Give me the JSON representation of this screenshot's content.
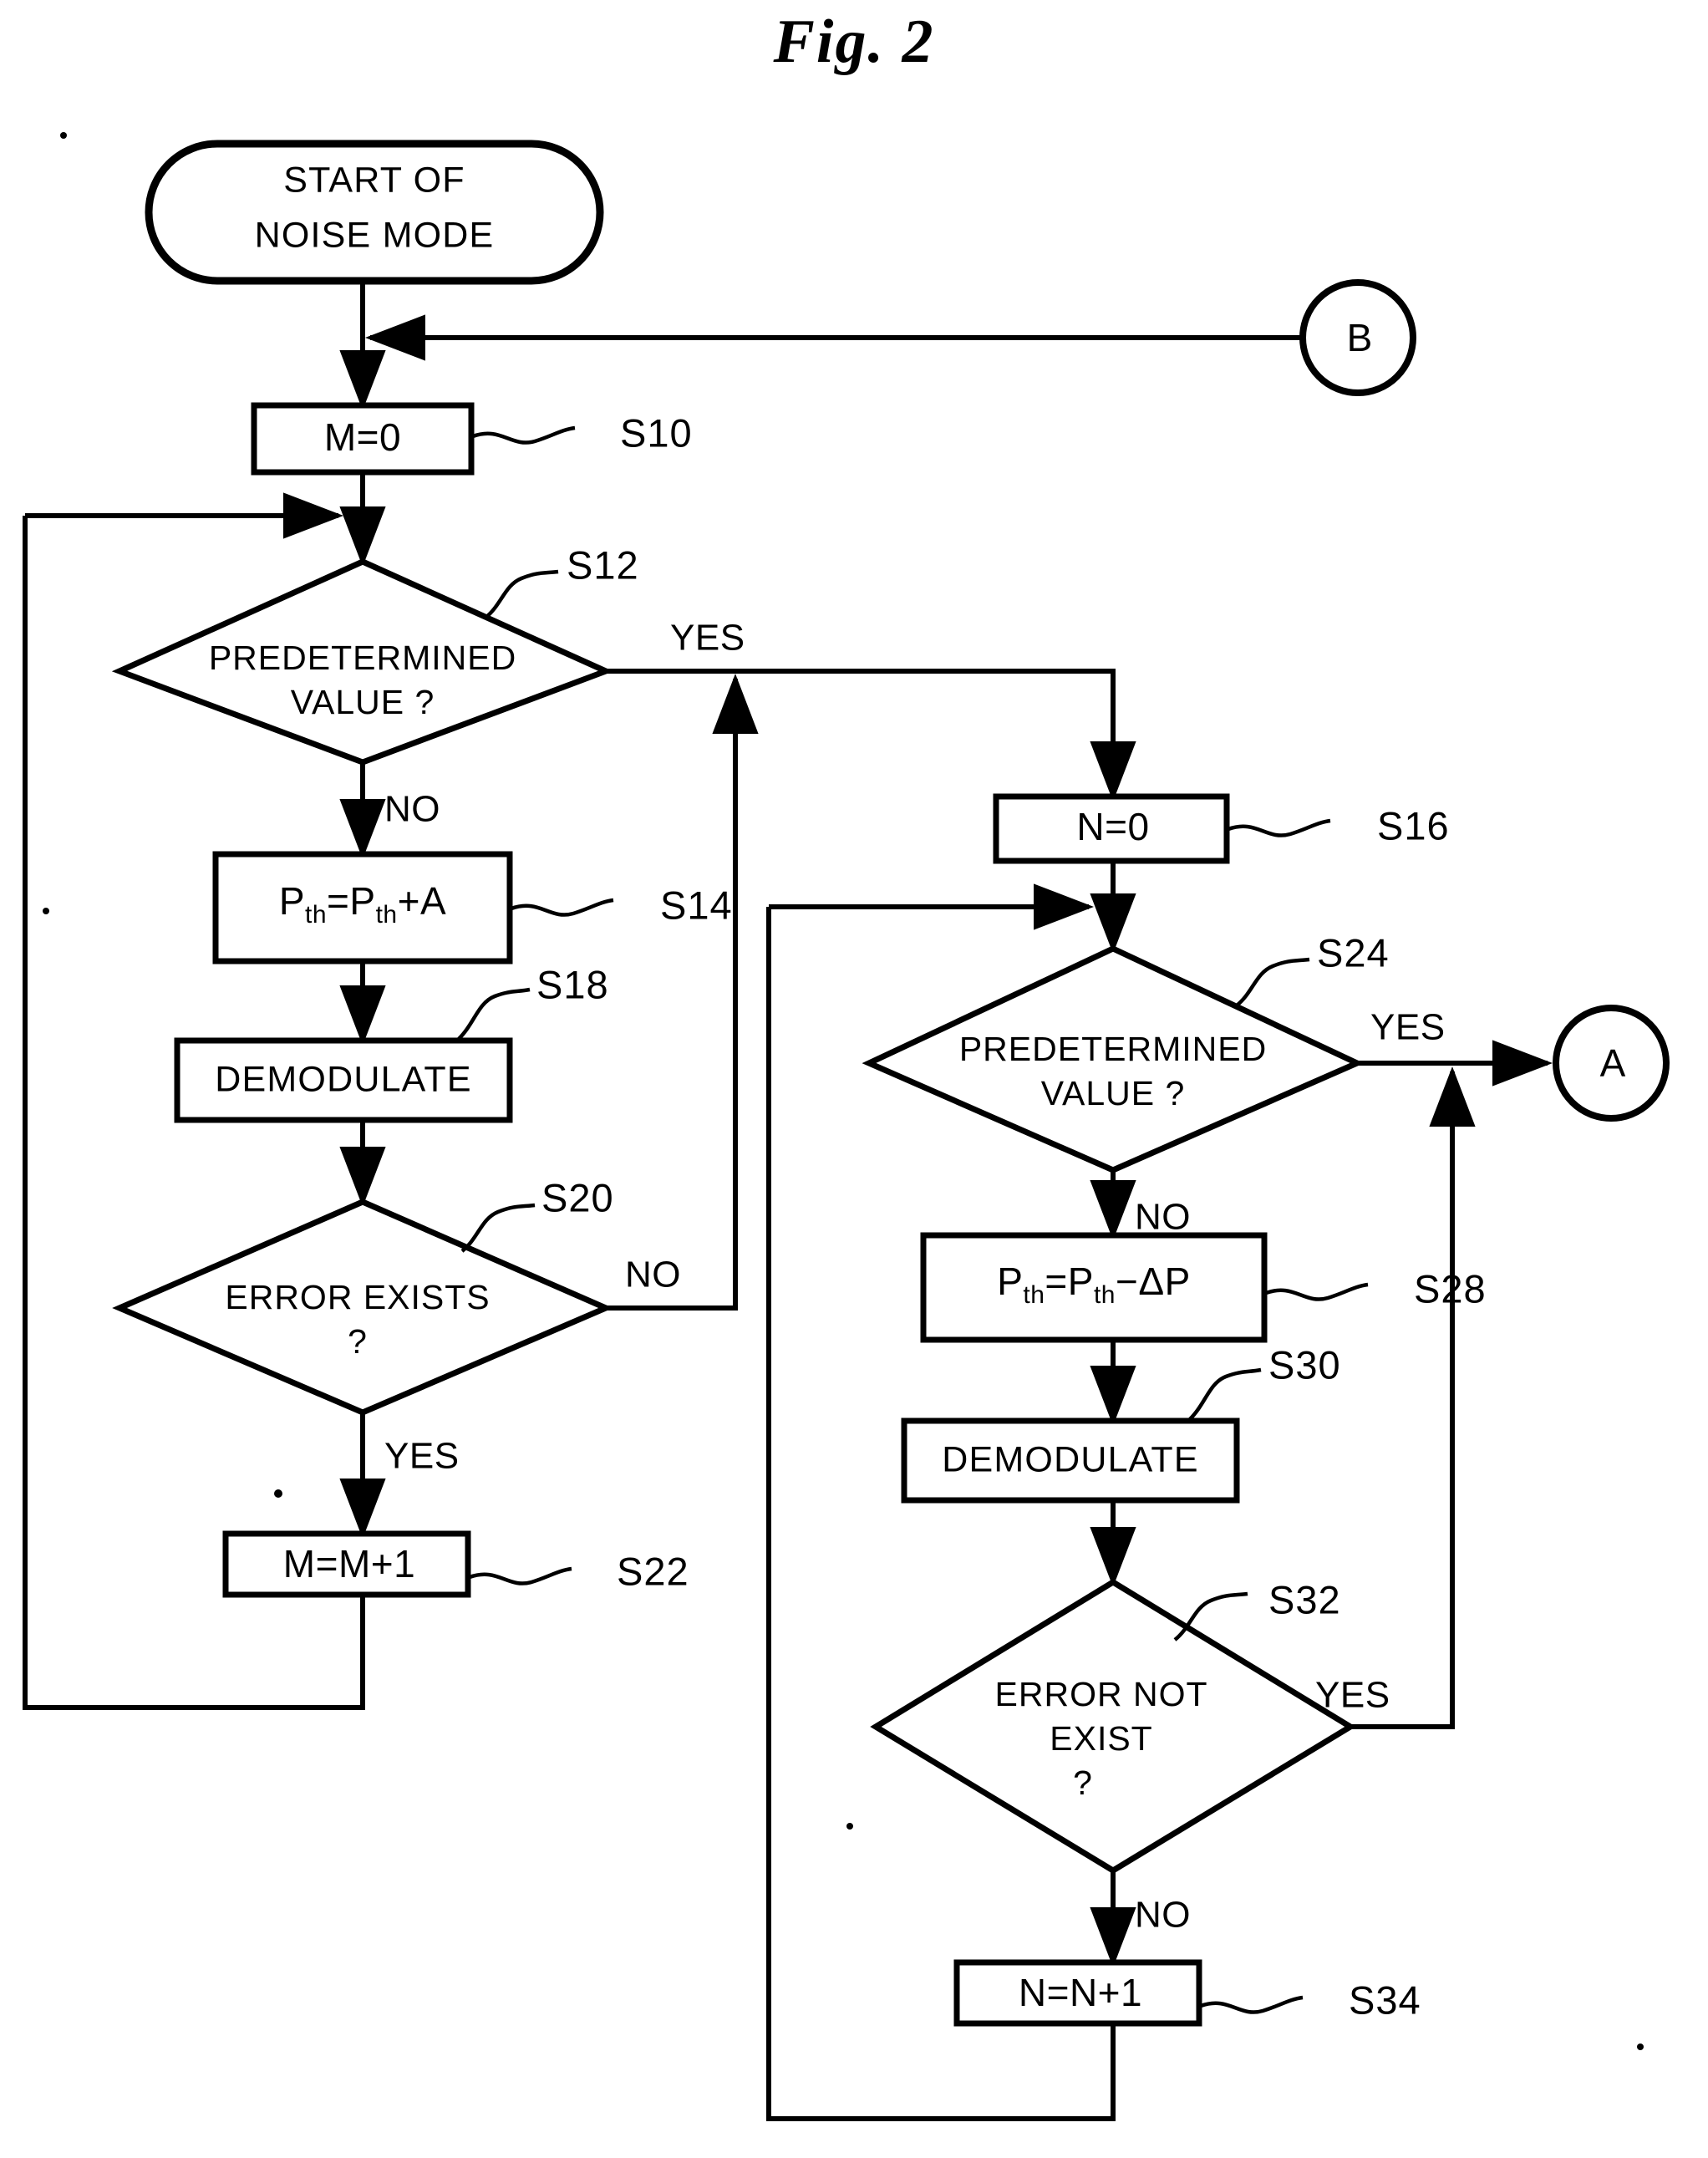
{
  "figure": {
    "title": "Fig. 2"
  },
  "flowchart": {
    "type": "flowchart",
    "orientation": "top-to-bottom",
    "nodes": [
      {
        "id": "start",
        "shape": "terminator",
        "lines": [
          "START  OF",
          "NOISE  MODE"
        ]
      },
      {
        "id": "s10",
        "shape": "process",
        "text": "M=0",
        "step": "S10"
      },
      {
        "id": "s12",
        "shape": "decision",
        "lines": [
          "PREDETERMINED",
          "VALUE ?"
        ],
        "step": "S12",
        "yes": "YES",
        "no": "NO"
      },
      {
        "id": "s14",
        "shape": "process",
        "text": "Pth=Pth+A",
        "lhs": "P",
        "lhs_sub": "th",
        "op1": "=",
        "rhs": "P",
        "rhs_sub": "th",
        "op2": "+",
        "operand": "A",
        "step": "S14"
      },
      {
        "id": "s18",
        "shape": "process",
        "text": "DEMODULATE",
        "step": "S18"
      },
      {
        "id": "s20",
        "shape": "decision",
        "lines": [
          "ERROR  EXISTS",
          "?"
        ],
        "step": "S20",
        "yes": "YES",
        "no": "NO"
      },
      {
        "id": "s22",
        "shape": "process",
        "text": "M=M+1",
        "step": "S22"
      },
      {
        "id": "s16",
        "shape": "process",
        "text": "N=0",
        "step": "S16"
      },
      {
        "id": "s24",
        "shape": "decision",
        "lines": [
          "PREDETERMINED",
          "VALUE ?"
        ],
        "step": "S24",
        "yes": "YES",
        "no": "NO"
      },
      {
        "id": "s28",
        "shape": "process",
        "text": "Pth=Pth-ΔP",
        "lhs": "P",
        "lhs_sub": "th",
        "op1": "=",
        "rhs": "P",
        "rhs_sub": "th",
        "op2": "−",
        "operand": "ΔP",
        "step": "S28"
      },
      {
        "id": "s30",
        "shape": "process",
        "text": "DEMODULATE",
        "step": "S30"
      },
      {
        "id": "s32",
        "shape": "decision",
        "lines": [
          "ERROR  NOT",
          "EXIST",
          "?"
        ],
        "step": "S32",
        "yes": "YES",
        "no": "NO"
      },
      {
        "id": "s34",
        "shape": "process",
        "text": "N=N+1",
        "step": "S34"
      },
      {
        "id": "connA",
        "shape": "connector",
        "text": "A"
      },
      {
        "id": "connB",
        "shape": "connector",
        "text": "B"
      }
    ],
    "labels": {
      "start_line1": "START  OF",
      "start_line2": "NOISE  MODE",
      "s10_text": "M=0",
      "s10_step": "S10",
      "s12_line1": "PREDETERMINED",
      "s12_line2": "VALUE ?",
      "s12_step": "S12",
      "s12_yes": "YES",
      "s12_no": "NO",
      "s14_p1": "P",
      "s14_sub1": "th",
      "s14_eq": "=",
      "s14_p2": "P",
      "s14_sub2": "th",
      "s14_plus": "+A",
      "s14_step": "S14",
      "s18_text": "DEMODULATE",
      "s18_step": "S18",
      "s20_line1": "ERROR  EXISTS",
      "s20_line2": "?",
      "s20_step": "S20",
      "s20_yes": "YES",
      "s20_no": "NO",
      "s22_text": "M=M+1",
      "s22_step": "S22",
      "s16_text": "N=0",
      "s16_step": "S16",
      "s24_line1": "PREDETERMINED",
      "s24_line2": "VALUE ?",
      "s24_step": "S24",
      "s24_yes": "YES",
      "s24_no": "NO",
      "s28_p1": "P",
      "s28_sub1": "th",
      "s28_eq": "=",
      "s28_p2": "P",
      "s28_sub2": "th",
      "s28_minus": "−ΔP",
      "s28_step": "S28",
      "s30_text": "DEMODULATE",
      "s30_step": "S30",
      "s32_line1": "ERROR  NOT",
      "s32_line2": "EXIST",
      "s32_line3": "?",
      "s32_step": "S32",
      "s32_yes": "YES",
      "s32_no": "NO",
      "s34_text": "N=N+1",
      "s34_step": "S34",
      "conn_a": "A",
      "conn_b": "B"
    },
    "edges": [
      {
        "from": "start",
        "to": "s10",
        "label": ""
      },
      {
        "from": "connB",
        "to": "start_to_s10",
        "label": ""
      },
      {
        "from": "s10",
        "to": "s12",
        "label": ""
      },
      {
        "from": "s12",
        "to": "s16",
        "label": "YES"
      },
      {
        "from": "s12",
        "to": "s14",
        "label": "NO"
      },
      {
        "from": "s14",
        "to": "s18",
        "label": ""
      },
      {
        "from": "s18",
        "to": "s20",
        "label": ""
      },
      {
        "from": "s20",
        "to": "s12_yes_line",
        "label": "NO"
      },
      {
        "from": "s20",
        "to": "s22",
        "label": "YES"
      },
      {
        "from": "s22",
        "to": "s12",
        "label": ""
      },
      {
        "from": "s16",
        "to": "s24",
        "label": ""
      },
      {
        "from": "s24",
        "to": "connA",
        "label": "YES"
      },
      {
        "from": "s24",
        "to": "s28",
        "label": "NO"
      },
      {
        "from": "s28",
        "to": "s30",
        "label": ""
      },
      {
        "from": "s30",
        "to": "s32",
        "label": ""
      },
      {
        "from": "s32",
        "to": "s24_yes_line",
        "label": "YES"
      },
      {
        "from": "s32",
        "to": "s34",
        "label": "NO"
      },
      {
        "from": "s34",
        "to": "s24",
        "label": ""
      }
    ]
  },
  "colors": {
    "ink": "#000000",
    "paper": "#ffffff"
  }
}
